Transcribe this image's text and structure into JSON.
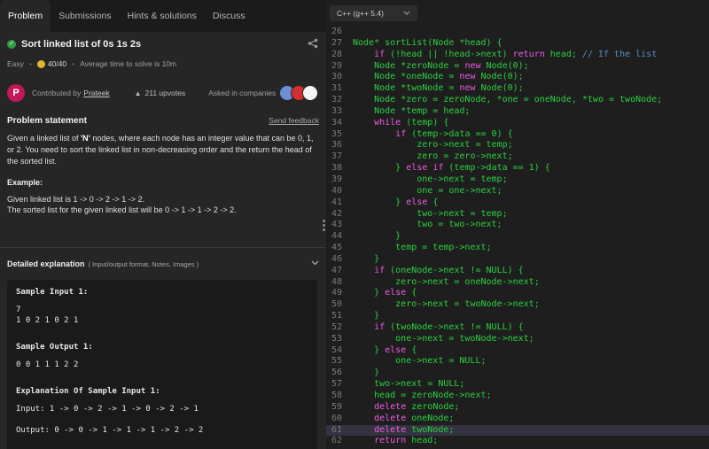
{
  "tabs": [
    "Problem",
    "Submissions",
    "Hints & solutions",
    "Discuss"
  ],
  "problem": {
    "title": "Sort linked list of 0s 1s 2s",
    "difficulty": "Easy",
    "score": "40/40",
    "avg_time": "Average time to solve is 10m",
    "contributed_label": "Contributed by",
    "author": "Prateek",
    "author_initial": "P",
    "upvotes": "211 upvotes",
    "companies_label": "Asked in companies",
    "company_logos": [
      "",
      "",
      ""
    ]
  },
  "statement": {
    "heading": "Problem statement",
    "feedback": "Send feedback",
    "p1_before": "Given a linked list of ",
    "p1_bold": "'N'",
    "p1_after": " nodes, where each node has an integer value that can be 0, 1, or 2. You need to sort the linked list in non-decreasing order and the return the head of the sorted list.",
    "example_heading": "Example:",
    "example_line1": "Given linked list is 1 -> 0 -> 2 -> 1 -> 2.",
    "example_line2": "The sorted list for the given linked list will be 0 -> 1 -> 1 -> 2 -> 2."
  },
  "detail": {
    "heading": "Detailed explanation",
    "sub": "( Input/output format, Notes, Images )"
  },
  "sample": {
    "input_heading": "Sample Input 1:",
    "input_line1": "7",
    "input_line2": "1 0 2 1 0 2 1",
    "output_heading": "Sample Output 1:",
    "output_line1": "0 0 1 1 1 2 2",
    "explain_heading": "Explanation Of Sample Input 1:",
    "explain_input": "Input: 1 -> 0 -> 2 -> 1 -> 0 -> 2 -> 1",
    "explain_output": "Output: 0 -> 0 -> 1 -> 1 -> 1 -> 2 -> 2"
  },
  "editor": {
    "language": "C++ (g++ 5.4)",
    "highlight_line": "61",
    "lines": [
      {
        "n": "26",
        "t": ""
      },
      {
        "n": "27",
        "t": "Node* sortList(Node *head) {"
      },
      {
        "n": "28",
        "t": "    if (!head || !head->next) return head; // If the list"
      },
      {
        "n": "29",
        "t": "    Node *zeroNode = new Node(0);"
      },
      {
        "n": "30",
        "t": "    Node *oneNode = new Node(0);"
      },
      {
        "n": "31",
        "t": "    Node *twoNode = new Node(0);"
      },
      {
        "n": "32",
        "t": "    Node *zero = zeroNode, *one = oneNode, *two = twoNode;"
      },
      {
        "n": "33",
        "t": "    Node *temp = head;"
      },
      {
        "n": "34",
        "t": "    while (temp) {"
      },
      {
        "n": "35",
        "t": "        if (temp->data == 0) {"
      },
      {
        "n": "36",
        "t": "            zero->next = temp;"
      },
      {
        "n": "37",
        "t": "            zero = zero->next;"
      },
      {
        "n": "38",
        "t": "        } else if (temp->data == 1) {"
      },
      {
        "n": "39",
        "t": "            one->next = temp;"
      },
      {
        "n": "40",
        "t": "            one = one->next;"
      },
      {
        "n": "41",
        "t": "        } else {"
      },
      {
        "n": "42",
        "t": "            two->next = temp;"
      },
      {
        "n": "43",
        "t": "            two = two->next;"
      },
      {
        "n": "44",
        "t": "        }"
      },
      {
        "n": "45",
        "t": "        temp = temp->next;"
      },
      {
        "n": "46",
        "t": "    }"
      },
      {
        "n": "47",
        "t": "    if (oneNode->next != NULL) {"
      },
      {
        "n": "48",
        "t": "        zero->next = oneNode->next;"
      },
      {
        "n": "49",
        "t": "    } else {"
      },
      {
        "n": "50",
        "t": "        zero->next = twoNode->next;"
      },
      {
        "n": "51",
        "t": "    }"
      },
      {
        "n": "52",
        "t": "    if (twoNode->next != NULL) {"
      },
      {
        "n": "53",
        "t": "        one->next = twoNode->next;"
      },
      {
        "n": "54",
        "t": "    } else {"
      },
      {
        "n": "55",
        "t": "        one->next = NULL;"
      },
      {
        "n": "56",
        "t": "    }"
      },
      {
        "n": "57",
        "t": "    two->next = NULL;"
      },
      {
        "n": "58",
        "t": "    head = zeroNode->next;"
      },
      {
        "n": "59",
        "t": "    delete zeroNode;"
      },
      {
        "n": "60",
        "t": "    delete oneNode;"
      },
      {
        "n": "61",
        "t": "    delete twoNode;"
      },
      {
        "n": "62",
        "t": "    return head;"
      }
    ]
  },
  "colors": {
    "code_text": "#2bd13f",
    "keyword": "#ee5ce4",
    "comment": "#5a8ec9",
    "panel_bg": "#262626",
    "editor_bg": "#1e1e1e"
  },
  "icons": {
    "solved": "check-circle-icon",
    "share": "share-icon",
    "coin": "coin-icon",
    "upvote": "arrow-up-icon",
    "collapse": "chevron-down-icon",
    "lang_dropdown": "chevron-down-icon"
  }
}
